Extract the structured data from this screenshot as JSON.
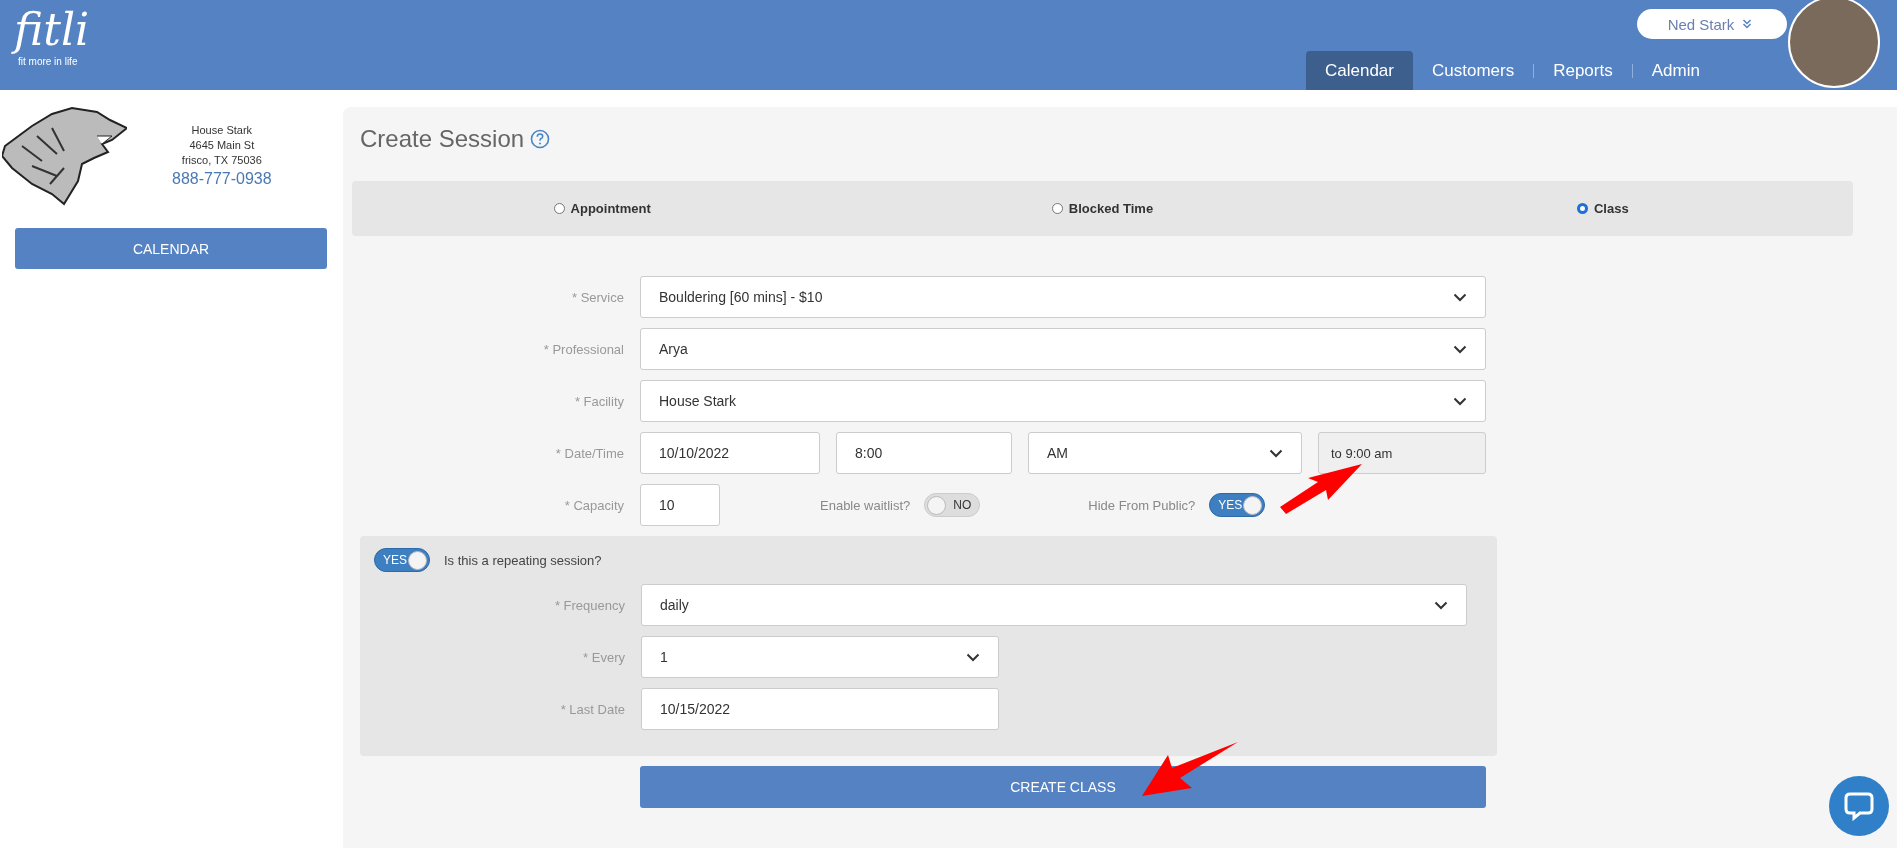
{
  "header": {
    "logo": {
      "wordmark": "fitli",
      "tagline": "fit more in life"
    },
    "user_menu": {
      "name": "Ned Stark"
    },
    "nav": [
      {
        "label": "Calendar",
        "selected": true
      },
      {
        "label": "Customers",
        "selected": false
      },
      {
        "label": "Reports",
        "selected": false
      },
      {
        "label": "Admin",
        "selected": false
      }
    ]
  },
  "sidebar": {
    "business": {
      "name": "House Stark",
      "address": "4645 Main St",
      "city": "frisco, TX 75036",
      "phone": "888-777-0938"
    },
    "button": "CALENDAR"
  },
  "page_title": "Create Session",
  "session_types": [
    {
      "label": "Appointment",
      "selected": false
    },
    {
      "label": "Blocked Time",
      "selected": false
    },
    {
      "label": "Class",
      "selected": true
    }
  ],
  "form": {
    "rows": [
      {
        "kind": "select",
        "label": "* Service",
        "value": "Bouldering [60 mins] - $10"
      },
      {
        "kind": "select",
        "label": "* Professional",
        "value": "Arya"
      },
      {
        "kind": "select",
        "label": "* Facility",
        "value": "House Stark"
      },
      {
        "kind": "datetime",
        "label": "* Date/Time",
        "date": "10/10/2022",
        "time": "8:00",
        "meridiem": "AM",
        "end": "to 9:00 am"
      },
      {
        "kind": "capacity",
        "label": "* Capacity",
        "value": "10",
        "toggles": [
          {
            "label": "Enable waitlist?",
            "on": false,
            "text": "NO"
          },
          {
            "label": "Hide From Public?",
            "on": true,
            "text": "YES"
          }
        ]
      }
    ]
  },
  "repeat": {
    "toggle": {
      "on": true,
      "text": "YES"
    },
    "label": "Is this a repeating session?",
    "rows": [
      {
        "kind": "select",
        "label": "* Frequency",
        "value": "daily"
      },
      {
        "kind": "select",
        "label": "* Every",
        "value": "1"
      },
      {
        "kind": "input",
        "label": "* Last Date",
        "value": "10/15/2022"
      }
    ]
  },
  "submit": "CREATE CLASS"
}
